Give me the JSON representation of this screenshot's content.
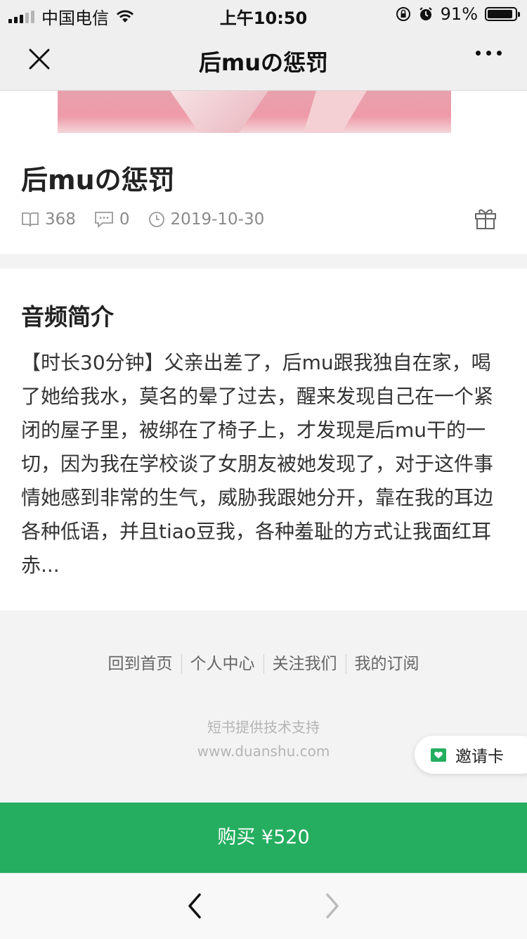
{
  "status_bar": {
    "carrier": "中国电信",
    "time": "上午10:50",
    "battery_pct_text": "91%",
    "battery_level": 0.91
  },
  "nav": {
    "title": "后muの惩罚",
    "icons": {
      "close": "close-icon",
      "more": "more-icon"
    }
  },
  "episode": {
    "title": "后muの惩罚",
    "plays": "368",
    "comments": "0",
    "date": "2019-10-30",
    "icons": [
      "book-icon",
      "comment-icon",
      "clock-icon",
      "gift-icon"
    ]
  },
  "intro": {
    "heading": "音频简介",
    "text": "【时长30分钟】父亲出差了，后mu跟我独自在家，喝了她给我水，莫名的晕了过去，醒来发现自己在一个紧闭的屋子里，被绑在了椅子上，才发现是后mu干的一切，因为我在学校谈了女朋友被她发现了，对于这件事情她感到非常的生气，威胁我跟她分开，靠在我的耳边各种低语，并且tiao豆我，各种羞耻的方式让我面红耳赤..."
  },
  "footer": {
    "links": [
      "回到首页",
      "个人中心",
      "关注我们",
      "我的订阅"
    ],
    "powered_by": "短书提供技术支持",
    "site": "www.duanshu.com"
  },
  "invite": {
    "label": "邀请卡"
  },
  "buy": {
    "label": "购买 ¥520"
  },
  "colors": {
    "accent_green": "#25ae5f",
    "page_bg": "#f3f3f3"
  }
}
